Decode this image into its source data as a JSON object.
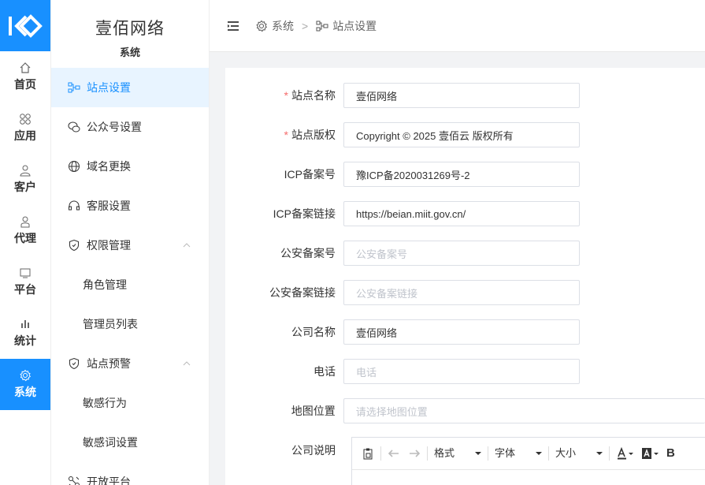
{
  "brand": {
    "title": "壹佰网络",
    "subtitle": "系统"
  },
  "rail": [
    {
      "icon": "home-icon",
      "label": "首页"
    },
    {
      "icon": "apps-icon",
      "label": "应用"
    },
    {
      "icon": "user-icon",
      "label": "客户"
    },
    {
      "icon": "agent-icon",
      "label": "代理"
    },
    {
      "icon": "monitor-icon",
      "label": "平台"
    },
    {
      "icon": "bar-chart-icon",
      "label": "统计"
    },
    {
      "icon": "gear-icon",
      "label": "系统",
      "active": true
    }
  ],
  "submenu": [
    {
      "icon": "site-settings-icon",
      "label": "站点设置",
      "active": true
    },
    {
      "icon": "wechat-icon",
      "label": "公众号设置"
    },
    {
      "icon": "globe-icon",
      "label": "域名更换"
    },
    {
      "icon": "headset-icon",
      "label": "客服设置"
    },
    {
      "icon": "shield-icon",
      "label": "权限管理",
      "expanded": true
    },
    {
      "label": "角色管理",
      "child": true
    },
    {
      "label": "管理员列表",
      "child": true
    },
    {
      "icon": "shield-icon",
      "label": "站点预警",
      "expanded": true
    },
    {
      "label": "敏感行为",
      "child": true
    },
    {
      "label": "敏感词设置",
      "child": true
    },
    {
      "icon": "open-platform-icon",
      "label": "开放平台"
    }
  ],
  "breadcrumb": {
    "root": "系统",
    "separator": ">",
    "current": "站点设置"
  },
  "form": {
    "site_name": {
      "label": "站点名称",
      "required": true,
      "value": "壹佰网络"
    },
    "site_copyright": {
      "label": "站点版权",
      "required": true,
      "value": "Copyright © 2025 壹佰云 版权所有"
    },
    "icp_number": {
      "label": "ICP备案号",
      "value": "豫ICP备2020031269号-2"
    },
    "icp_link": {
      "label": "ICP备案链接",
      "value": "https://beian.miit.gov.cn/"
    },
    "police_number": {
      "label": "公安备案号",
      "placeholder": "公安备案号"
    },
    "police_link": {
      "label": "公安备案链接",
      "placeholder": "公安备案链接"
    },
    "company_name": {
      "label": "公司名称",
      "value": "壹佰网络"
    },
    "phone": {
      "label": "电话",
      "placeholder": "电话"
    },
    "map_location": {
      "label": "地图位置",
      "placeholder": "请选择地图位置"
    },
    "company_desc": {
      "label": "公司说明"
    }
  },
  "editor_toolbar": {
    "format": "格式",
    "font": "字体",
    "size": "大小",
    "bold": "B"
  },
  "colors": {
    "primary": "#1890ff",
    "active_bg": "#e8f4ff",
    "required": "#f56c6c"
  }
}
